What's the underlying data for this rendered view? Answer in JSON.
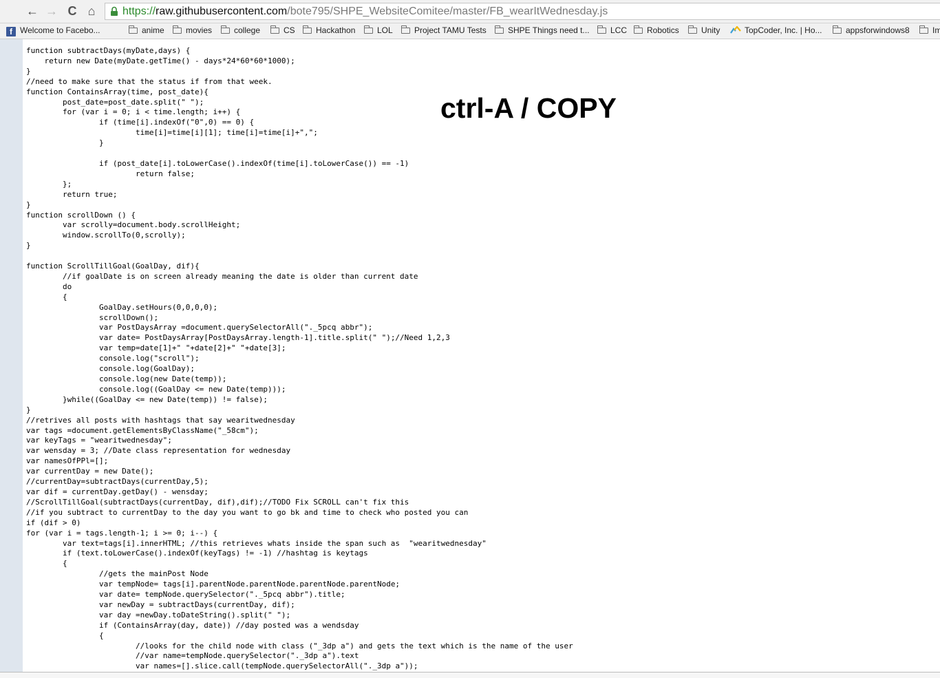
{
  "browser": {
    "back_glyph": "←",
    "forward_glyph": "→",
    "reload_glyph": "C",
    "home_glyph": "⌂",
    "url_scheme": "https://",
    "url_host": "raw.githubusercontent.com",
    "url_path": "/bote795/SHPE_WebsiteComitee/master/FB_wearItWednesday.js"
  },
  "bookmarks": [
    {
      "label": "Welcome to Facebo...",
      "icon": "facebook-icon"
    },
    {
      "label": "anime",
      "icon": "folder-icon"
    },
    {
      "label": "movies",
      "icon": "folder-icon"
    },
    {
      "label": "college",
      "icon": "folder-icon"
    },
    {
      "label": "CS",
      "icon": "folder-icon"
    },
    {
      "label": "Hackathon",
      "icon": "folder-icon"
    },
    {
      "label": "LOL",
      "icon": "folder-icon"
    },
    {
      "label": "Project TAMU Tests",
      "icon": "folder-icon"
    },
    {
      "label": "SHPE Things need t...",
      "icon": "folder-icon"
    },
    {
      "label": "LCC",
      "icon": "folder-icon"
    },
    {
      "label": "Robotics",
      "icon": "folder-icon"
    },
    {
      "label": "Unity",
      "icon": "folder-icon"
    },
    {
      "label": "TopCoder, Inc. | Ho...",
      "icon": "topcoder-icon"
    },
    {
      "label": "appsforwindows8",
      "icon": "folder-icon"
    },
    {
      "label": "Im",
      "icon": "folder-icon"
    }
  ],
  "page": {
    "overlay_text": "ctrl-A / COPY",
    "code": "function subtractDays(myDate,days) {\n    return new Date(myDate.getTime() - days*24*60*60*1000);\n}\n//need to make sure that the status if from that week.\nfunction ContainsArray(time, post_date){\n\tpost_date=post_date.split(\" \");\n\tfor (var i = 0; i < time.length; i++) {\n\t\tif (time[i].indexOf(\"0\",0) == 0) {\n\t\t\ttime[i]=time[i][1]; time[i]=time[i]+\",\";\n\t\t}\n\n\t\tif (post_date[i].toLowerCase().indexOf(time[i].toLowerCase()) == -1)\n\t\t\treturn false;\n\t};\n\treturn true;\n}\nfunction scrollDown () {\n\tvar scrolly=document.body.scrollHeight;\n\twindow.scrollTo(0,scrolly);\n}\n\nfunction ScrollTillGoal(GoalDay, dif){\n\t//if goalDate is on screen already meaning the date is older than current date\n\tdo\n\t{\n\t\tGoalDay.setHours(0,0,0,0);\n\t\tscrollDown();\n\t\tvar PostDaysArray =document.querySelectorAll(\"._5pcq abbr\");\n\t\tvar date= PostDaysArray[PostDaysArray.length-1].title.split(\" \");//Need 1,2,3\n\t\tvar temp=date[1]+\" \"+date[2]+\" \"+date[3];\n\t\tconsole.log(\"scroll\");\n\t\tconsole.log(GoalDay);\n\t\tconsole.log(new Date(temp));\n\t\tconsole.log((GoalDay <= new Date(temp)));\n\t}while((GoalDay <= new Date(temp)) != false);\n}\n//retrives all posts with hashtags that say wearitwednesday\nvar tags =document.getElementsByClassName(\"_58cm\");\nvar keyTags = \"wearitwednesday\";\nvar wensday = 3; //Date class representation for wednesday\nvar namesOfPPl=[];\nvar currentDay = new Date();\n//currentDay=subtractDays(currentDay,5);\nvar dif = currentDay.getDay() - wensday;\n//ScrollTillGoal(subtractDays(currentDay, dif),dif);//TODO Fix SCROLL can't fix this\n//if you subtract to currentDay to the day you want to go bk and time to check who posted you can\nif (dif > 0)\nfor (var i = tags.length-1; i >= 0; i--) {\n\tvar text=tags[i].innerHTML; //this retrieves whats inside the span such as  \"wearitwednesday\"\n\tif (text.toLowerCase().indexOf(keyTags) != -1) //hashtag is keytags\n\t{\n\t\t//gets the mainPost Node\n\t\tvar tempNode= tags[i].parentNode.parentNode.parentNode.parentNode;\n\t\tvar date= tempNode.querySelector(\"._5pcq abbr\").title;\n\t\tvar newDay = subtractDays(currentDay, dif);\n\t\tvar day =newDay.toDateString().split(\" \");\n\t\tif (ContainsArray(day, date)) //day posted was a wendsday\n\t\t{\n\t\t\t//looks for the child node with class (\"_3dp a\") and gets the text which is the name of the user\n\t\t\t//var name=tempNode.querySelector(\"._3dp a\").text\n\t\t\tvar names=[].slice.call(tempNode.querySelectorAll(\"._3dp a\"));"
  }
}
